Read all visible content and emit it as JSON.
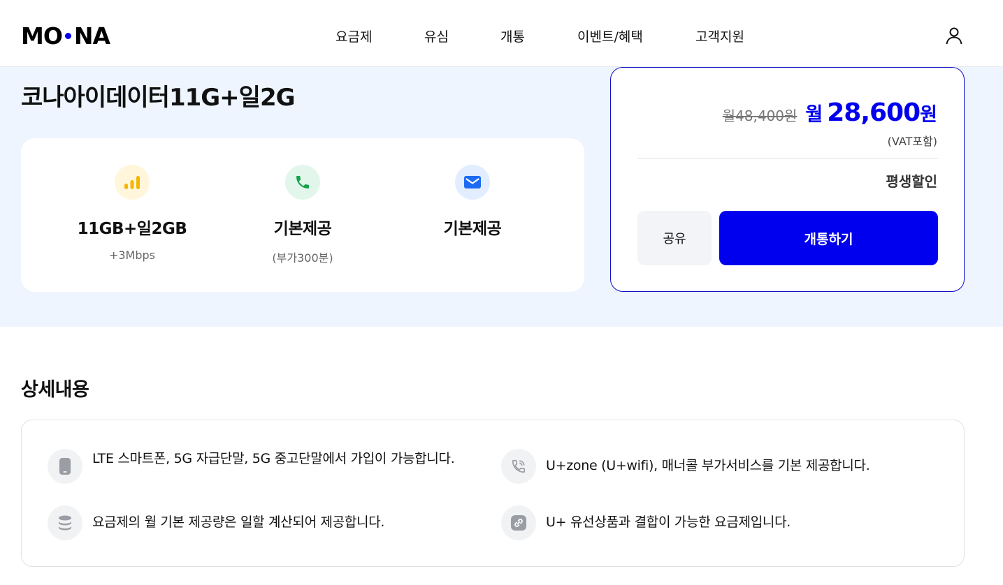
{
  "header": {
    "logo_left": "MO",
    "logo_right": "NA",
    "nav": [
      {
        "label": "요금제"
      },
      {
        "label": "유심"
      },
      {
        "label": "개통"
      },
      {
        "label": "이벤트/혜택"
      },
      {
        "label": "고객지원"
      }
    ]
  },
  "plan": {
    "title": "코나아이데이터11G+일2G",
    "features": [
      {
        "title": "11GB+일2GB",
        "sub": "+3Mbps",
        "icon": "signal-bars-icon",
        "icon_bg": "#fff6dc",
        "icon_color": "#f7b500"
      },
      {
        "title": "기본제공",
        "sub": "(부가300분)",
        "icon": "phone-icon",
        "icon_bg": "#e3f6ec",
        "icon_color": "#16a34a"
      },
      {
        "title": "기본제공",
        "sub": "",
        "icon": "mail-icon",
        "icon_bg": "#e2edff",
        "icon_color": "#1d6bf3"
      }
    ]
  },
  "price": {
    "original": "월48,400원",
    "month_label": "월",
    "sale": "28,600",
    "won": "원",
    "vat": "(VAT포함)",
    "discount": "평생할인",
    "share_label": "공유",
    "activate_label": "개통하기"
  },
  "details": {
    "title": "상세내용",
    "items": [
      {
        "text": "LTE 스마트폰, 5G 자급단말, 5G 중고단말에서 가입이 가능합니다.",
        "icon": "smartphone-icon"
      },
      {
        "text": "U+zone (U+wifi), 매너콜 부가서비스를 기본 제공합니다.",
        "icon": "phone-call-icon"
      },
      {
        "text": "요금제의 월 기본 제공량은 일할 계산되어 제공합니다.",
        "icon": "database-icon"
      },
      {
        "text": "U+ 유선상품과 결합이 가능한 요금제입니다.",
        "icon": "link-icon"
      }
    ]
  },
  "colors": {
    "accent": "#0000ee",
    "hero_bg": "#eef5ff"
  }
}
